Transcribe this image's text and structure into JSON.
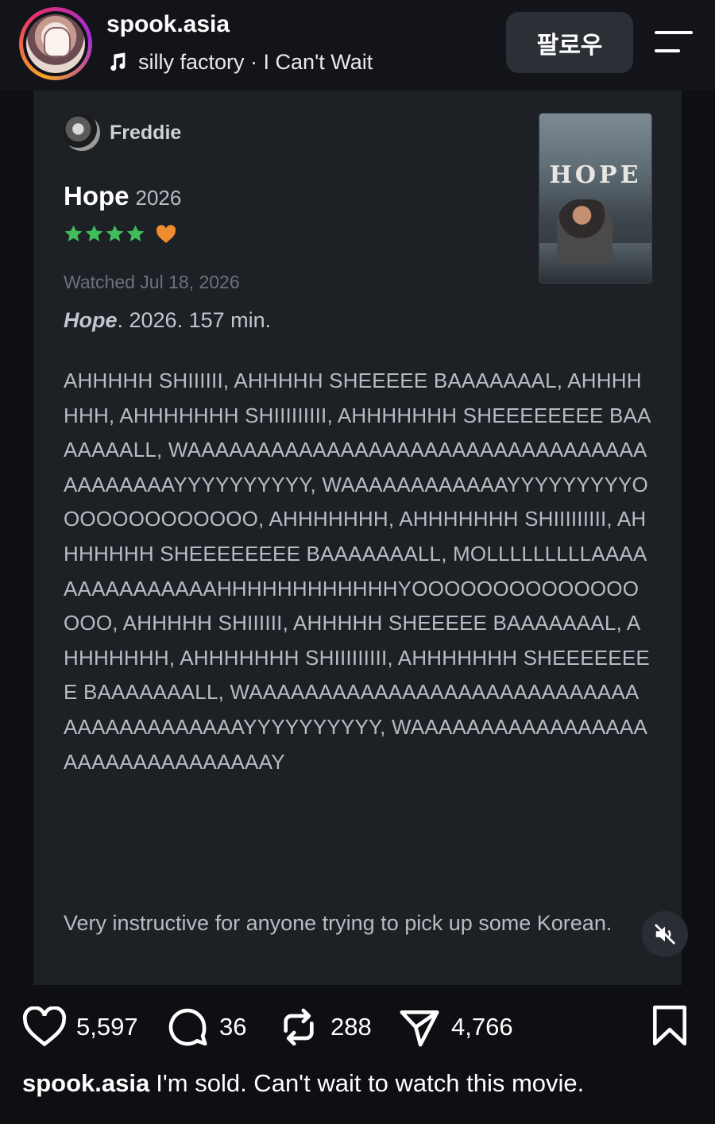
{
  "header": {
    "username": "spook.asia",
    "music_artist": "silly factory",
    "music_separator": " · ",
    "music_song": "I Can't Wait",
    "follow_label": "팔로우",
    "icons": {
      "music": "music-note-icon",
      "menu": "menu-icon"
    }
  },
  "review": {
    "reviewer_name": "Freddie",
    "film_title": "Hope",
    "film_year": "2026",
    "rating_stars": 4,
    "liked": true,
    "watched_text": "Watched Jul 18, 2026",
    "meta_title": "Hope",
    "meta_rest": ". 2026. 157 min.",
    "body": "AHHHHH SHIIIIII, AHHHHH SHEEEEE BAAAAAAAL, AHHHHHHH, AHHHHHHH SHIIIIIIIII, AHHHHHHH SHEEEEEEEE BAAAAAAALL, WAAAAAAAAAAAAAAAAAAAAAAAAAAAAAAAAAAAAAAAAAYYYYYYYYYY, WAAAAAAAAAAAAYYYYYYYYYOOOOOOOOOOOOO, AHHHHHHH, AHHHHHHH SHIIIIIIIII, AHHHHHHH SHEEEEEEEE BAAAAAAALL, MOLLLLLLLLLAAAAAAAAAAAAAAAHHHHHHHHHHHHYOOOOOOOOOOOOOOOOO, AHHHHH SHIIIIII, AHHHHH SHEEEEE BAAAAAAAL, AHHHHHHH, AHHHHHHH SHIIIIIIIII, AHHHHHHH SHEEEEEEEE BAAAAAAALL, WAAAAAAAAAAAAAAAAAAAAAAAAAAAAAAAAAAAAAAAAAYYYYYYYYYY, WAAAAAAAAAAAAAAAAAAAAAAAAAAAAAAAAY",
    "note": "Very instructive for anyone trying to pick up some Korean.",
    "poster_title": "HOPE"
  },
  "media": {
    "mute_icon": "speaker-muted-icon"
  },
  "actions": {
    "likes": "5,597",
    "comments": "36",
    "reposts": "288",
    "shares": "4,766",
    "icons": [
      "heart-icon",
      "comment-icon",
      "repost-icon",
      "share-icon",
      "bookmark-icon"
    ]
  },
  "caption": {
    "username": "spook.asia",
    "text": "I'm sold. Can't wait to watch this movie."
  },
  "colors": {
    "star": "#40bc5a",
    "heart": "#f08d2f",
    "card": "#1d2025",
    "background": "#0d0f13"
  }
}
